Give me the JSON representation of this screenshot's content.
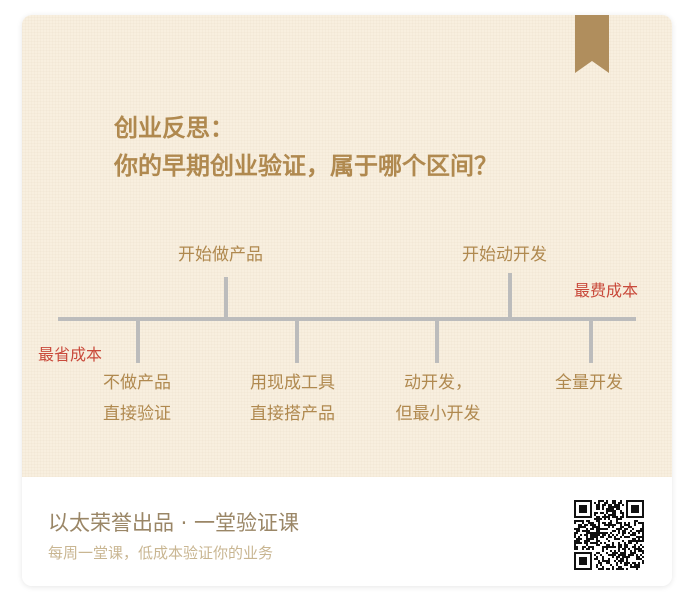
{
  "heading": {
    "line1": "创业反思：",
    "line2": "你的早期创业验证，属于哪个区间？"
  },
  "timeline": {
    "left_label": "最省成本",
    "right_label": "最费成本",
    "above": [
      {
        "text": "开始做产品"
      },
      {
        "text": "开始动开发"
      }
    ],
    "below": [
      {
        "line1": "不做产品",
        "line2": "直接验证"
      },
      {
        "line1": "用现成工具",
        "line2": "直接搭产品"
      },
      {
        "line1": "动开发，",
        "line2": "但最小开发"
      },
      {
        "line1": "全量开发",
        "line2": ""
      }
    ]
  },
  "footer": {
    "title": "以太荣誉出品 · 一堂验证课",
    "subtitle": "每周一堂课，低成本验证你的业务"
  },
  "colors": {
    "paper": "#f8efdf",
    "accent_gold": "#b0894f",
    "cost_red": "#c94a3b",
    "axis_gray": "#bcbcbc",
    "bookmark": "#b08e5d"
  },
  "icons": {
    "bookmark": "bookmark-ribbon-icon",
    "qr": "qr-code-icon"
  }
}
